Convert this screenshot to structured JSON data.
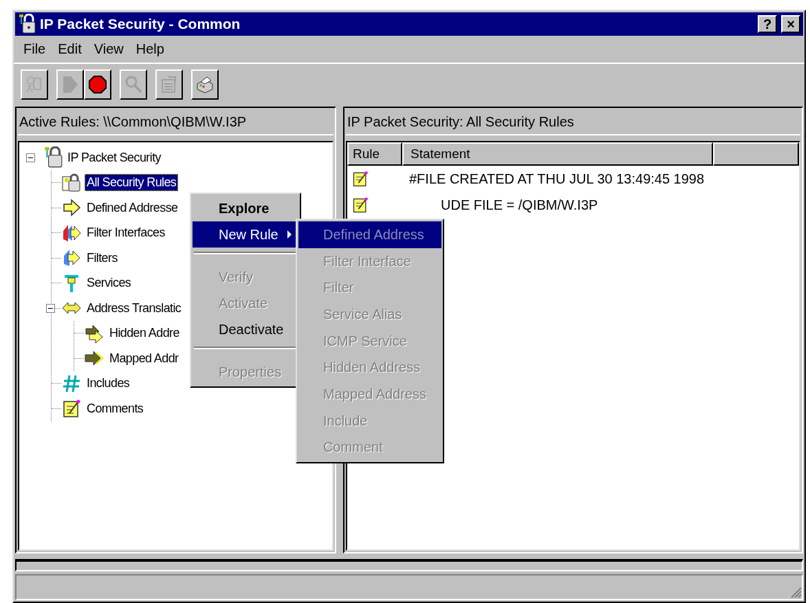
{
  "window": {
    "title": "IP Packet Security - Common",
    "buttons": [
      "?",
      "×"
    ]
  },
  "menu": [
    "File",
    "Edit",
    "View",
    "Help"
  ],
  "toolbar": [
    {
      "kind": "wizard",
      "disabled": true
    },
    {
      "kind": "start",
      "disabled": true
    },
    {
      "kind": "stop",
      "disabled": false
    },
    {
      "kind": "find",
      "disabled": true
    },
    {
      "kind": "properties",
      "disabled": true
    },
    {
      "kind": "print",
      "disabled": false
    }
  ],
  "left_pane": {
    "header": "Active Rules: \\\\Common\\QIBM\\W.I3P",
    "tree": {
      "label": "IP Packet Security",
      "kind": "root",
      "expanded": true,
      "selected": false,
      "children": [
        {
          "label": "All Security Rules",
          "kind": "rules",
          "selected": true
        },
        {
          "label": "Defined Addresse",
          "kind": "address",
          "selected": false
        },
        {
          "label": "Filter Interfaces",
          "kind": "interface",
          "selected": false
        },
        {
          "label": "Filters",
          "kind": "filter",
          "selected": false
        },
        {
          "label": "Services",
          "kind": "service",
          "selected": false
        },
        {
          "label": "Address Translatic",
          "kind": "translation",
          "selected": false,
          "expanded": true,
          "children": [
            {
              "label": "Hidden Addre",
              "kind": "hidden",
              "selected": false
            },
            {
              "label": "Mapped Addr",
              "kind": "mapped",
              "selected": false
            }
          ]
        },
        {
          "label": "Includes",
          "kind": "include",
          "selected": false
        },
        {
          "label": "Comments",
          "kind": "comment",
          "selected": false
        }
      ]
    }
  },
  "right_pane": {
    "header": "IP Packet Security: All Security Rules",
    "table": {
      "columns": [
        "Rule",
        "Statement"
      ],
      "rows": [
        {
          "statement": "#FILE CREATED AT THU JUL 30 13:49:45 1998",
          "covered": false
        },
        {
          "statement": "UDE FILE = /QIBM/W.I3P",
          "covered": true
        }
      ]
    }
  },
  "context_menu": {
    "items": [
      {
        "kind": "item",
        "label": "Explore",
        "default": true,
        "disabled": false,
        "selected": false,
        "submenu": false
      },
      {
        "kind": "item",
        "label": "New Rule",
        "default": false,
        "disabled": false,
        "selected": true,
        "submenu": true
      },
      {
        "kind": "separator"
      },
      {
        "kind": "item",
        "label": "Verify",
        "default": false,
        "disabled": true,
        "selected": false,
        "submenu": false
      },
      {
        "kind": "item",
        "label": "Activate",
        "default": false,
        "disabled": true,
        "selected": false,
        "submenu": false
      },
      {
        "kind": "item",
        "label": "Deactivate",
        "default": false,
        "disabled": false,
        "selected": false,
        "submenu": false
      },
      {
        "kind": "separator"
      },
      {
        "kind": "item",
        "label": "Properties",
        "default": false,
        "disabled": true,
        "selected": false,
        "submenu": false
      }
    ]
  },
  "submenu": {
    "items": [
      {
        "label": "Defined Address",
        "disabled": true,
        "selected": true
      },
      {
        "label": "Filter Interface",
        "disabled": true,
        "selected": false
      },
      {
        "label": "Filter",
        "disabled": true,
        "selected": false
      },
      {
        "label": "Service Alias",
        "disabled": true,
        "selected": false
      },
      {
        "label": "ICMP Service",
        "disabled": true,
        "selected": false
      },
      {
        "label": "Hidden Address",
        "disabled": true,
        "selected": false
      },
      {
        "label": "Mapped Address",
        "disabled": true,
        "selected": false
      },
      {
        "label": "Include",
        "disabled": true,
        "selected": false
      },
      {
        "label": "Comment",
        "disabled": true,
        "selected": false
      }
    ]
  }
}
